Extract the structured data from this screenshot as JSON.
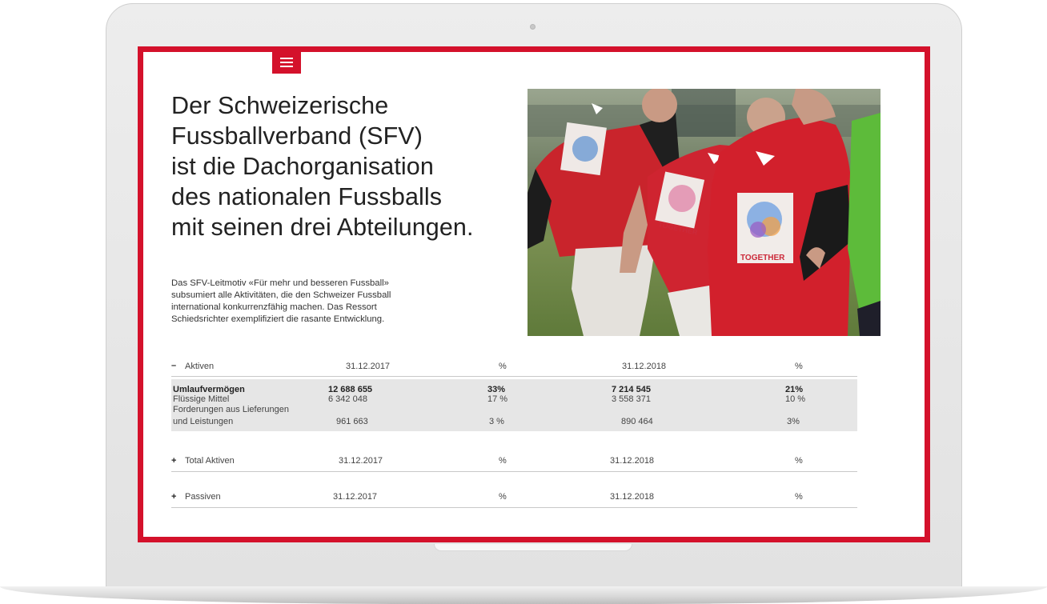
{
  "headline": {
    "lines": [
      "Der Schweizerische",
      "Fussballverband (SFV)",
      "ist die Dachorganisation",
      "des nationalen Fussballs",
      "mit seinen drei Abteilungen."
    ]
  },
  "intro": {
    "lines": [
      "Das SFV-Leitmotiv «Für mehr und besseren Fussball»",
      "subsumiert alle Aktivitäten, die den Schweizer Fussball",
      "international konkurrenzfähig machen. Das Ressort",
      "Schiedsrichter exemplifiziert die rasante Entwicklung."
    ]
  },
  "photo": {
    "shirt_texts": [
      "TOGETHER",
      "TOGETHER"
    ]
  },
  "icons": {
    "menu": "hamburger-menu-icon",
    "collapse": "minus-icon",
    "expand": "plus-icon"
  },
  "colors": {
    "accent": "#d4112b",
    "table_highlight": "#e6e6e6"
  },
  "table": {
    "aktiven": {
      "toggle": "–",
      "label": "Aktiven",
      "col1": "31.12.2017",
      "col2": "%",
      "col3": "31.12.2018",
      "col4": "%"
    },
    "details": {
      "umlauf": {
        "label": "Umlaufvermögen",
        "v2017": "12 688 655",
        "p2017": "33%",
        "v2018": "7 214 545",
        "p2018": "21%"
      },
      "fluessig": {
        "label": "Flüssige Mittel",
        "v2017": "6 342 048",
        "p2017": "17 %",
        "v2018": "3 558 371",
        "p2018": "10 %"
      },
      "forderungen": {
        "label1": "Forderungen aus Lieferungen",
        "label2": "und Leistungen",
        "v2017": "961 663",
        "p2017": "3 %",
        "v2018": "890 464",
        "p2018": "3%"
      }
    },
    "total_aktiven": {
      "toggle": "+",
      "label": "Total Aktiven",
      "col1": "31.12.2017",
      "col2": "%",
      "col3": "31.12.2018",
      "col4": "%"
    },
    "passiven": {
      "toggle": "+",
      "label": "Passiven",
      "col1": "31.12.2017",
      "col2": "%",
      "col3": "31.12.2018",
      "col4": "%"
    }
  }
}
